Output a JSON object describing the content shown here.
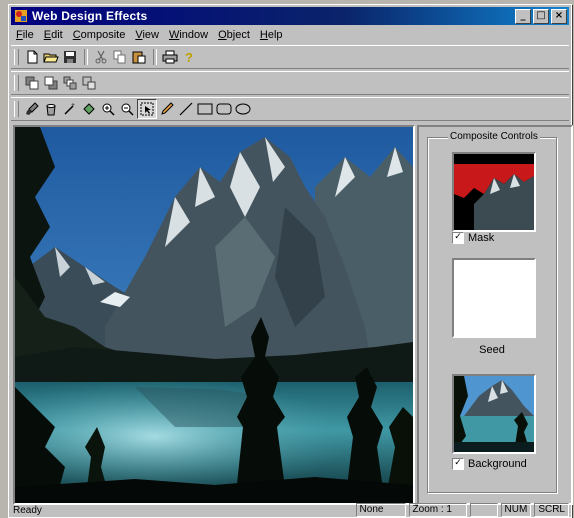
{
  "window": {
    "title": "Web Design Effects",
    "min": "_",
    "max": "□",
    "close": "×"
  },
  "menu": [
    {
      "underline": "F",
      "rest": "ile"
    },
    {
      "underline": "E",
      "rest": "dit"
    },
    {
      "underline": "C",
      "rest": "omposite"
    },
    {
      "underline": "V",
      "rest": "iew"
    },
    {
      "underline": "W",
      "rest": "indow"
    },
    {
      "underline": "O",
      "rest": "bject"
    },
    {
      "underline": "H",
      "rest": "elp"
    }
  ],
  "panel": {
    "title": "Composite Controls",
    "mask_label": "Mask",
    "mask_checked": "✓",
    "seed_label": "Seed",
    "background_label": "Background",
    "background_checked": "✓"
  },
  "status": {
    "text": "Ready",
    "object": "None",
    "zoom": "Zoom : 1",
    "num": "NUM",
    "scrl": "SCRL"
  },
  "colors": {
    "titlebar": "#000080",
    "mask_red": "#c8181a",
    "sky": "#2d6fb0",
    "water": "#2f7a86"
  }
}
